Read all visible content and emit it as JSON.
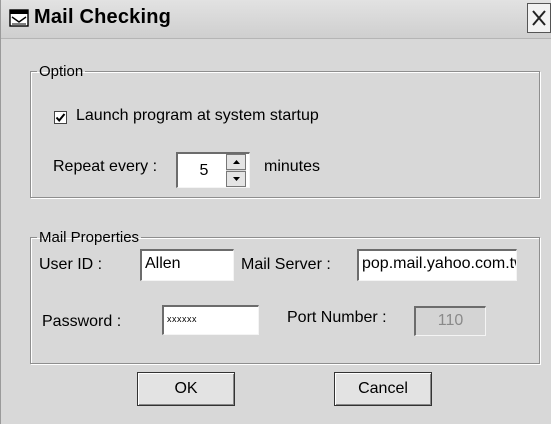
{
  "window": {
    "title": "Mail Checking",
    "icons": {
      "app": "envelope-window-icon",
      "close": "close-icon"
    }
  },
  "option": {
    "legend": "Option",
    "launch_label": "Launch program at system startup",
    "launch_checked": true,
    "repeat_label": "Repeat every :",
    "repeat_value": "5",
    "repeat_unit": "minutes"
  },
  "mail": {
    "legend": "Mail Properties",
    "user_id_label": "User ID :",
    "user_id": "Allen",
    "server_label": "Mail Server :",
    "server": "pop.mail.yahoo.com.tw",
    "password_label": "Password :",
    "password_mask": "xxxxxx",
    "port_label": "Port Number :",
    "port": "110"
  },
  "buttons": {
    "ok": "OK",
    "cancel": "Cancel"
  }
}
